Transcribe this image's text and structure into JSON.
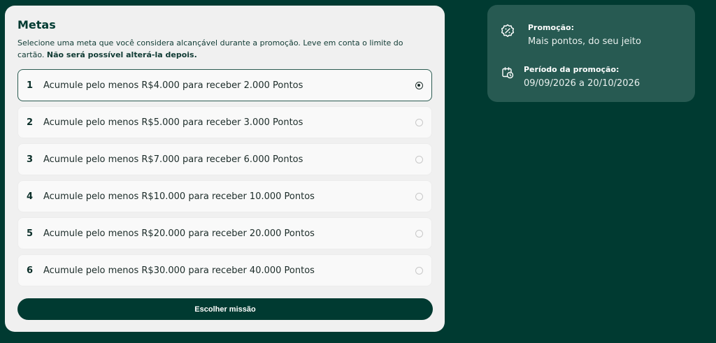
{
  "metas": {
    "title": "Metas",
    "description": "Selecione uma meta que você considera alcançável durante a promoção. Leve em conta o limite do cartão.",
    "description_bold": "Não será possível alterá-la depois.",
    "options": [
      {
        "number": "1",
        "text": "Acumule pelo menos R$4.000 para receber 2.000 Pontos",
        "selected": true
      },
      {
        "number": "2",
        "text": "Acumule pelo menos R$5.000 para receber 3.000 Pontos",
        "selected": false
      },
      {
        "number": "3",
        "text": "Acumule pelo menos R$7.000 para receber 6.000 Pontos",
        "selected": false
      },
      {
        "number": "4",
        "text": "Acumule pelo menos R$10.000 para receber 10.000 Pontos",
        "selected": false
      },
      {
        "number": "5",
        "text": "Acumule pelo menos R$20.000 para receber 20.000 Pontos",
        "selected": false
      },
      {
        "number": "6",
        "text": "Acumule pelo menos R$30.000 para receber 40.000 Pontos",
        "selected": false
      }
    ],
    "button_label": "Escolher missão"
  },
  "promo": {
    "promotion_label": "Promoção:",
    "promotion_value": "Mais pontos, do seu jeito",
    "period_label": "Período da promoção:",
    "period_value": "09/09/2026 a 20/10/2026",
    "icons": {
      "promotion": "discount-badge-icon",
      "period": "calendar-clock-icon"
    }
  },
  "colors": {
    "background": "#003a31",
    "card": "#f0f0f0",
    "info_card": "#275a52",
    "button": "#003a31"
  }
}
